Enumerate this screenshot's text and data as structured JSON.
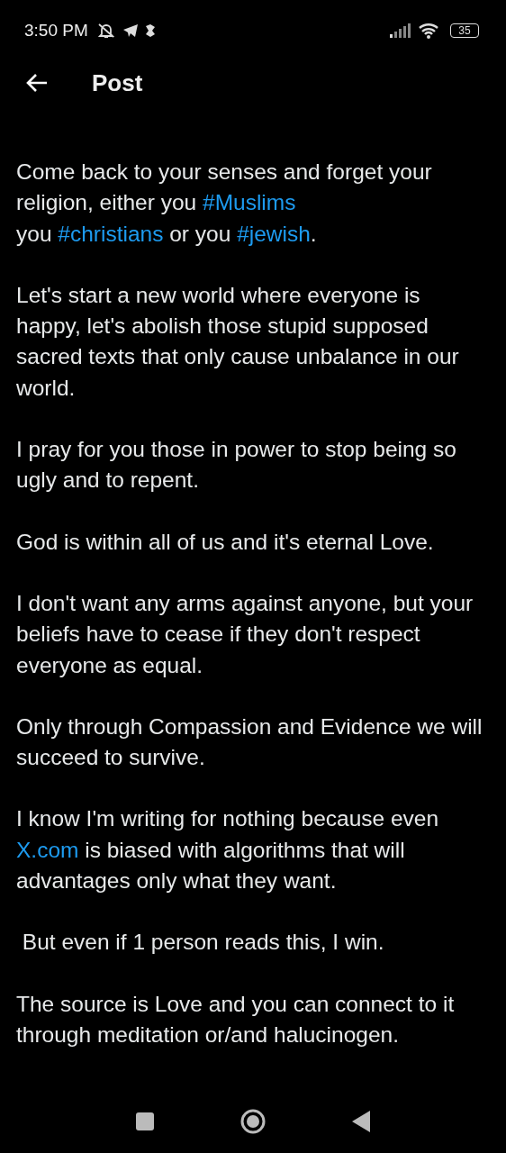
{
  "status_bar": {
    "time": "3:50 PM",
    "battery": "35"
  },
  "header": {
    "title": "Post"
  },
  "post": {
    "paragraphs": [
      [
        {
          "kind": "text",
          "text": "Come back to your senses and forget your religion, either you "
        },
        {
          "kind": "link",
          "text": "#Muslims"
        },
        {
          "kind": "break"
        },
        {
          "kind": "text",
          "text": "you "
        },
        {
          "kind": "link",
          "text": "#christians"
        },
        {
          "kind": "text",
          "text": " or you "
        },
        {
          "kind": "link",
          "text": "#jewish"
        },
        {
          "kind": "text",
          "text": "."
        }
      ],
      [
        {
          "kind": "text",
          "text": "Let's start a new world where everyone is happy, let's abolish those stupid supposed sacred texts that only cause unbalance in our world."
        }
      ],
      [
        {
          "kind": "text",
          "text": "I pray for you those in power to stop being so ugly and to repent."
        }
      ],
      [
        {
          "kind": "text",
          "text": "God is within all of us and it's eternal Love."
        }
      ],
      [
        {
          "kind": "text",
          "text": "I don't want any arms against anyone, but your beliefs have to cease if they don't respect everyone as equal."
        }
      ],
      [
        {
          "kind": "text",
          "text": "Only through Compassion and Evidence we will succeed to survive."
        }
      ],
      [
        {
          "kind": "text",
          "text": "I know I'm writing for nothing because even "
        },
        {
          "kind": "link",
          "text": "X.com"
        },
        {
          "kind": "text",
          "text": " is biased with algorithms that will advantages only what they want."
        }
      ],
      [
        {
          "kind": "text",
          "text": " But even if 1 person reads this, I win."
        }
      ],
      [
        {
          "kind": "text",
          "text": "The source is Love and you can connect to it through meditation or/and halucinogen."
        }
      ]
    ]
  }
}
